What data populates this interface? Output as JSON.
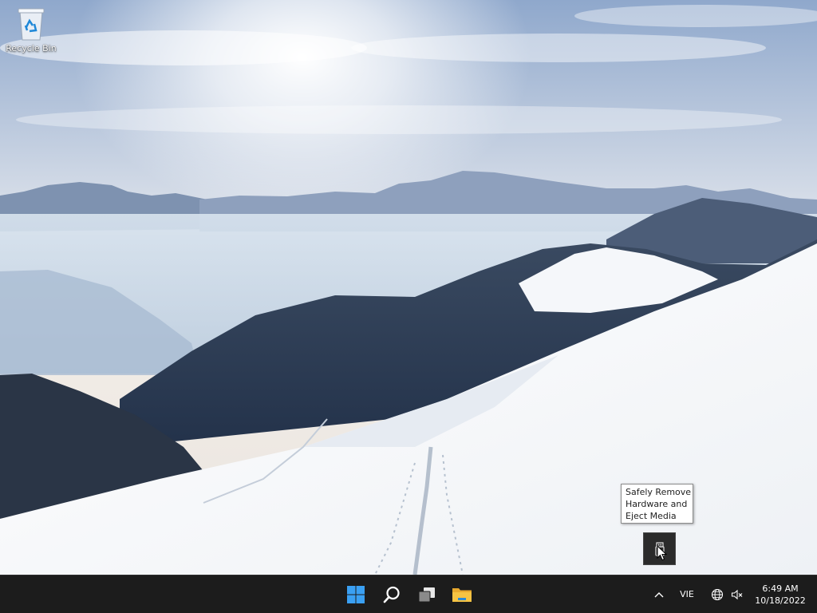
{
  "desktop": {
    "icons": [
      {
        "label": "Recycle Bin",
        "icon": "recycle-bin-icon"
      }
    ]
  },
  "tooltip": {
    "lines": [
      "Safely Remove",
      "Hardware and",
      "Eject Media"
    ]
  },
  "tray_flyout": {
    "icons": [
      "usb-eject-icon"
    ]
  },
  "taskbar": {
    "pinned": [
      {
        "name": "start",
        "icon": "windows-logo-icon"
      },
      {
        "name": "search",
        "icon": "search-icon"
      },
      {
        "name": "task-view",
        "icon": "task-view-icon"
      },
      {
        "name": "file-explorer",
        "icon": "folder-icon"
      }
    ],
    "tray": {
      "chevron_icon": "chevron-up-icon",
      "language": "VIE",
      "network_icon": "globe-network-icon",
      "volume_icon": "speaker-muted-icon",
      "time": "6:49 AM",
      "date": "10/18/2022"
    },
    "colors": {
      "background": "#1c1c1c",
      "start_blue": "#3aa0f3",
      "folder_yellow": "#f6c343"
    }
  }
}
